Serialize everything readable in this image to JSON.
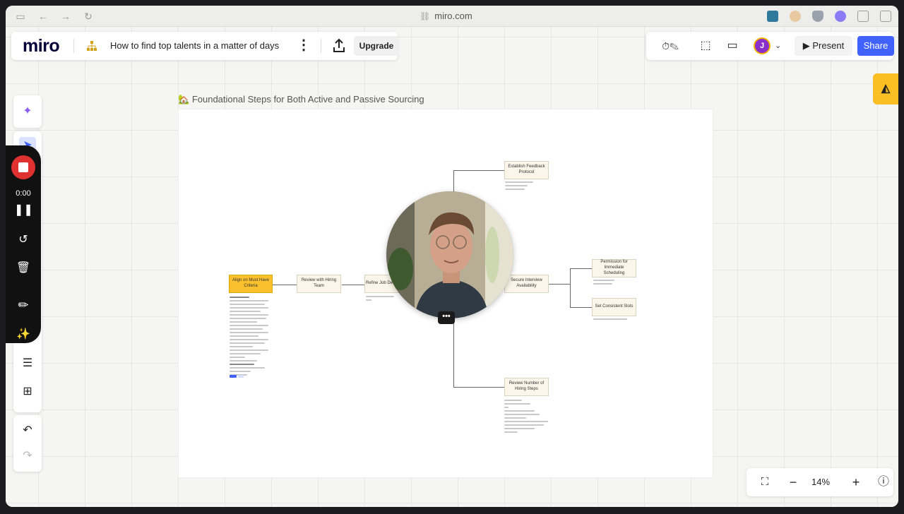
{
  "browser": {
    "url": "miro.com"
  },
  "app": {
    "logo": "miro",
    "board_title": "How to find top talents in a matter of days",
    "upgrade_label": "Upgrade",
    "present_label": "Present",
    "share_label": "Share",
    "avatar_initial": "J",
    "accent_color": "#4262ff",
    "avatar_color": "#8b2fc9"
  },
  "recording": {
    "time": "0:00"
  },
  "frame": {
    "title": "Foundational Steps for Both Active and Passive Sourcing",
    "title_icon": "house-icon"
  },
  "nodes": {
    "align": "Align on Must Have Criteria",
    "review_team": "Review with Hiring Team",
    "refine_job": "Refine Job Desc",
    "establish_feedback": "Establish Feedback Protocol",
    "secure_interview": "Secure Interview Availability",
    "permission": "Permission for Immediate Scheduling",
    "set_slots": "Set Consistent Slots",
    "review_steps": "Review Number of Hiring Steps"
  },
  "zoom": {
    "level": "14%"
  }
}
